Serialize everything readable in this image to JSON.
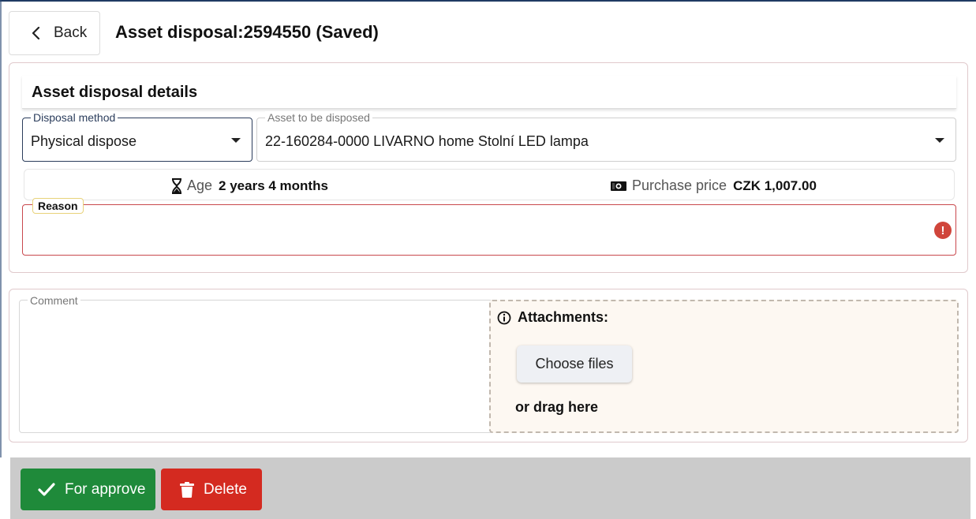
{
  "header": {
    "back_label": "Back",
    "title": "Asset disposal:2594550 (Saved)"
  },
  "details": {
    "section_title": "Asset disposal details",
    "disposal_method": {
      "label": "Disposal method",
      "value": "Physical dispose"
    },
    "asset": {
      "label": "Asset to be disposed",
      "value": "22-160284-0000 LIVARNO home Stolní LED lampa"
    },
    "age": {
      "label": "Age",
      "value": "2 years 4 months"
    },
    "purchase_price": {
      "label": "Purchase price",
      "value": "CZK 1,007.00"
    },
    "reason": {
      "label": "Reason",
      "value": ""
    }
  },
  "comment": {
    "label": "Comment",
    "value": ""
  },
  "attachments": {
    "title": "Attachments:",
    "choose_label": "Choose files",
    "drag_label": "or drag here"
  },
  "actions": {
    "approve_label": "For approve",
    "delete_label": "Delete"
  },
  "colors": {
    "approve": "#1f8a3a",
    "delete": "#d42a20",
    "error": "#d0453b",
    "action_bar": "#cbcbcb"
  },
  "icons": {
    "back": "chevron-left-icon",
    "age": "hourglass-icon",
    "price": "money-icon",
    "error": "exclamation-icon",
    "info": "info-icon",
    "approve": "check-icon",
    "delete": "trash-icon"
  }
}
